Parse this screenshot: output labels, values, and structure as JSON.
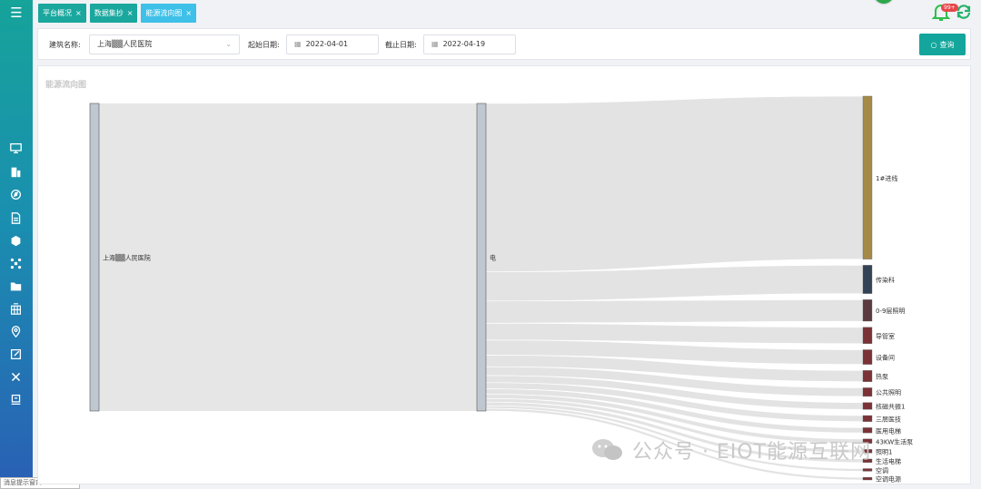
{
  "tabs": [
    {
      "label": "平台概况",
      "close": "×",
      "active": false
    },
    {
      "label": "数据集抄",
      "close": "×",
      "active": false
    },
    {
      "label": "能源流向图",
      "close": "×",
      "active": true
    }
  ],
  "notifications": {
    "badge": "99+"
  },
  "filter": {
    "building_label": "建筑名称:",
    "building_value": "上海▒▒人民医院",
    "start_label": "起始日期:",
    "start_value": "2022-04-01",
    "end_label": "截止日期:",
    "end_value": "2022-04-19",
    "query_label": "查询"
  },
  "panel": {
    "title": "能源流向图"
  },
  "chart_data": {
    "type": "sankey",
    "source": "上海▒▒人民医院",
    "middle": "电",
    "targets": [
      {
        "name": "1#进线",
        "color": "#a58a47",
        "weight": 190
      },
      {
        "name": "传染科",
        "color": "#334255",
        "weight": 33
      },
      {
        "name": "0-9层照明",
        "color": "#5a3a3f",
        "weight": 25
      },
      {
        "name": "导管室",
        "color": "#7a3236",
        "weight": 19
      },
      {
        "name": "设备间",
        "color": "#7a3236",
        "weight": 17
      },
      {
        "name": "热泵",
        "color": "#7a3236",
        "weight": 13
      },
      {
        "name": "公共照明",
        "color": "#7a3236",
        "weight": 10
      },
      {
        "name": "核磁共振1",
        "color": "#7a3236",
        "weight": 8
      },
      {
        "name": "三层医技",
        "color": "#7a3236",
        "weight": 7
      },
      {
        "name": "医用电梯",
        "color": "#7a3236",
        "weight": 6
      },
      {
        "name": "43KW生活泵",
        "color": "#7a3236",
        "weight": 5
      },
      {
        "name": "照明1",
        "color": "#7a3236",
        "weight": 4
      },
      {
        "name": "生活电梯",
        "color": "#7a3236",
        "weight": 4
      },
      {
        "name": "空调",
        "color": "#7a3236",
        "weight": 3
      },
      {
        "name": "空调电源",
        "color": "#7a3236",
        "weight": 3
      }
    ]
  },
  "msg_window": "消息提示窗口",
  "watermark": "公众号 · EIOT能源互联网"
}
